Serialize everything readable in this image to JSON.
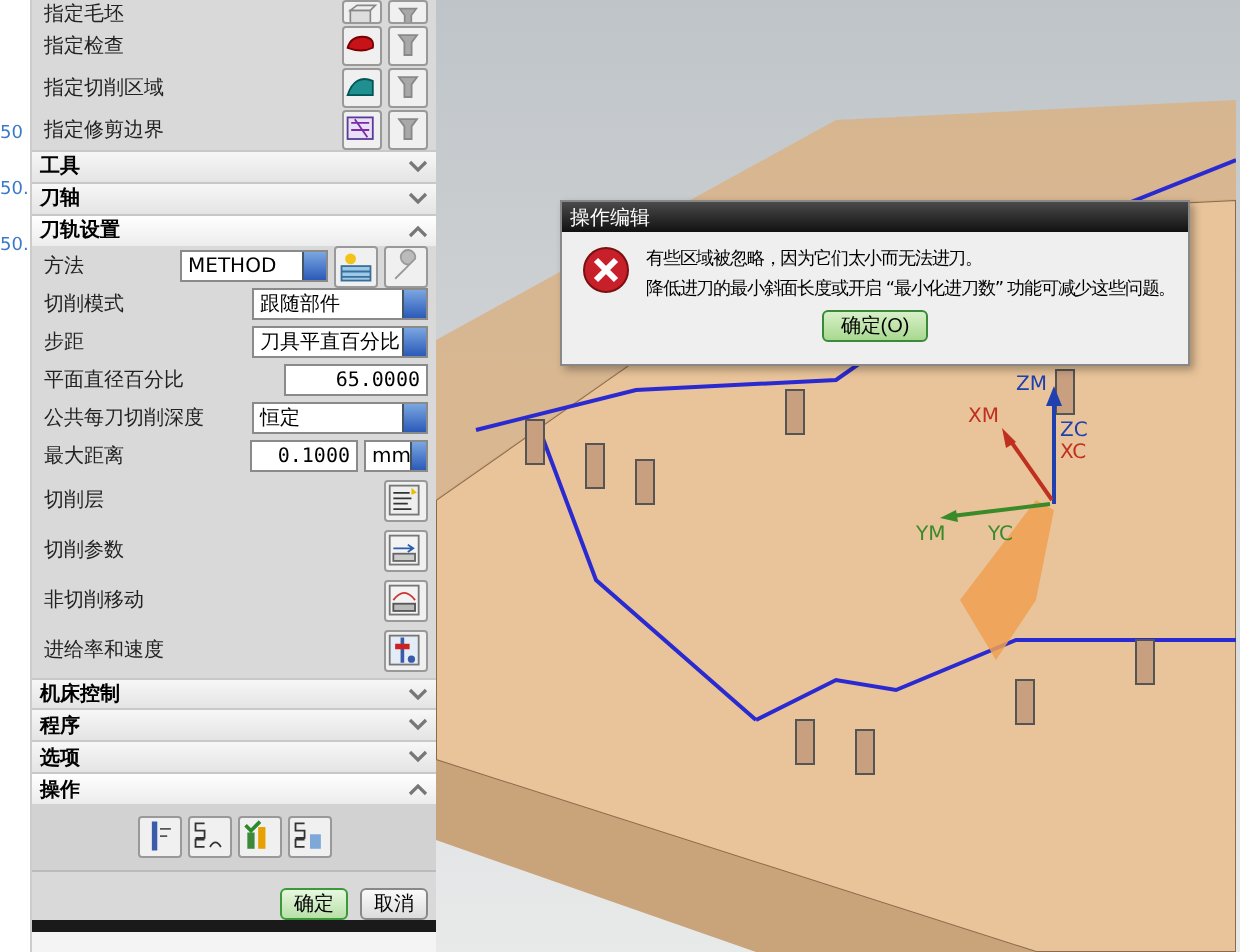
{
  "background_list": {
    "cells": [
      "50",
      "50.",
      "50."
    ]
  },
  "dialog": {
    "geometry_rows": [
      {
        "label": "指定毛坯"
      },
      {
        "label": "指定检查"
      },
      {
        "label": "指定切削区域"
      },
      {
        "label": "指定修剪边界"
      }
    ],
    "sections": [
      {
        "title": "工具",
        "expanded": false
      },
      {
        "title": "刀轴",
        "expanded": false
      },
      {
        "title": "刀轨设置",
        "expanded": true
      }
    ],
    "method": {
      "label": "方法",
      "value": "METHOD"
    },
    "fields": [
      {
        "kind": "select",
        "label": "切削模式",
        "value": "跟随部件"
      },
      {
        "kind": "select",
        "label": "步距",
        "value": "刀具平直百分比"
      },
      {
        "kind": "input",
        "label": "平面直径百分比",
        "value": "65.0000"
      },
      {
        "kind": "select",
        "label": "公共每刀切削深度",
        "value": "恒定"
      },
      {
        "kind": "unit",
        "label": "最大距离",
        "value": "0.1000",
        "unit": "mm"
      },
      {
        "kind": "button",
        "label": "切削层"
      },
      {
        "kind": "button",
        "label": "切削参数"
      },
      {
        "kind": "button",
        "label": "非切削移动"
      },
      {
        "kind": "button",
        "label": "进给率和速度"
      }
    ],
    "lower_sections": [
      {
        "title": "机床控制",
        "expanded": false
      },
      {
        "title": "程序",
        "expanded": false
      },
      {
        "title": "选项",
        "expanded": false
      },
      {
        "title": "操作",
        "expanded": true
      }
    ],
    "buttons": [
      {
        "label": "确定",
        "kind": "ok"
      },
      {
        "label": "取消",
        "kind": "cancel"
      }
    ]
  },
  "message_box": {
    "title": "操作编辑",
    "lines": [
      "有些区域被忽略，因为它们太小而无法进刀。",
      "降低进刀的最小斜面长度或开启 “最小化进刀数” 功能可减少这些问题。"
    ],
    "button": "确定(O)"
  },
  "viewport": {
    "axis_labels": [
      "ZM",
      "XM",
      "ZC",
      "XC",
      "YM",
      "YC"
    ]
  }
}
